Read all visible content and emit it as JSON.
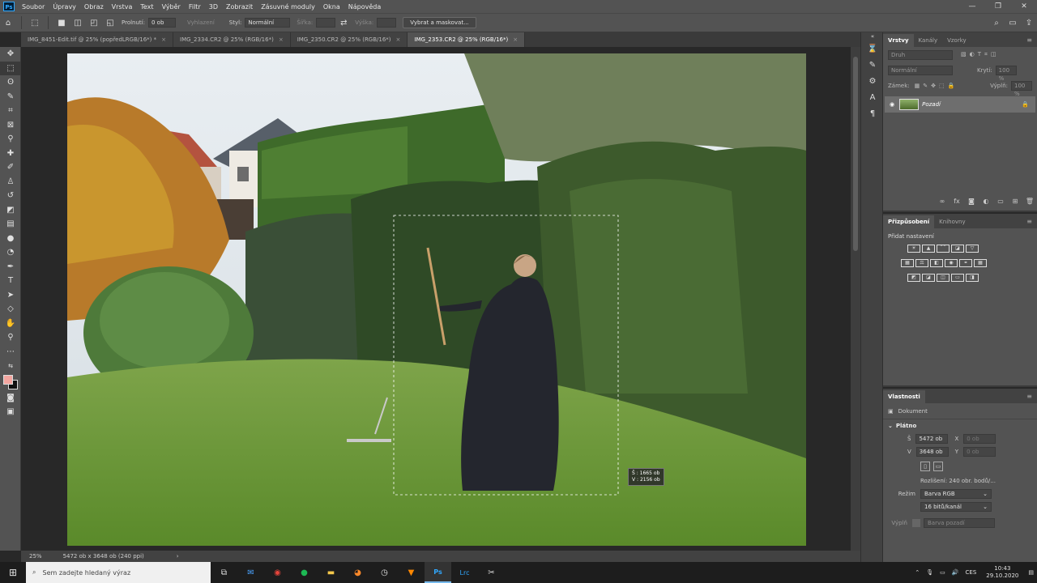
{
  "menubar": {
    "logo": "Ps",
    "items": [
      "Soubor",
      "Úpravy",
      "Obraz",
      "Vrstva",
      "Text",
      "Výběr",
      "Filtr",
      "3D",
      "Zobrazit",
      "Zásuvné moduly",
      "Okna",
      "Nápověda"
    ],
    "window_controls": [
      "—",
      "❐",
      "✕"
    ]
  },
  "options": {
    "feather_label": "Prolnutí:",
    "feather_value": "0 ob",
    "antialias_label": "Vyhlazení",
    "style_label": "Styl:",
    "style_value": "Normální",
    "width_label": "Šířka:",
    "height_label": "Výška:",
    "select_mask_button": "Vybrat a maskovat..."
  },
  "tabs": [
    {
      "label": "IMG_8451-Edit.tif @ 25% (popředLRGB/16*) *",
      "active": false
    },
    {
      "label": "IMG_2334.CR2 @ 25% (RGB/16*)",
      "active": false
    },
    {
      "label": "IMG_2350.CR2 @ 25% (RGB/16*)",
      "active": false
    },
    {
      "label": "IMG_2353.CR2 @ 25% (RGB/16*)",
      "active": true
    }
  ],
  "tab_close": "×",
  "canvas": {
    "selection_readout": {
      "w_label": "Š :",
      "w_value": "1665 ob",
      "h_label": "V :",
      "h_value": "2156 ob"
    }
  },
  "status": {
    "zoom": "25%",
    "doc_size": "5472 ob x 3648 ob (240 ppi)",
    "arrow": "›"
  },
  "layers_panel": {
    "tabs": [
      "Vrstvy",
      "Kanály",
      "Vzorky"
    ],
    "kind_placeholder": "Druh",
    "blend_mode": "Normální",
    "opacity_label": "Krytí:",
    "opacity_value": "100 %",
    "lock_label": "Zámek:",
    "fill_label": "Výplň:",
    "fill_value": "100 %",
    "layer_name": "Pozadí"
  },
  "adjust_panel": {
    "tabs": [
      "Přizpůsobení",
      "Knihovny"
    ],
    "add_label": "Přidat nastavení"
  },
  "props_panel": {
    "title": "Vlastnosti",
    "doc_label": "Dokument",
    "section": "Plátno",
    "w_label": "Š",
    "w_value": "5472 ob",
    "x_label": "X",
    "x_placeholder": "0 ob",
    "h_label": "V",
    "h_value": "3648 ob",
    "y_label": "Y",
    "y_placeholder": "0 ob",
    "resolution": "Rozlišení: 240 obr. bodů/...",
    "mode_label": "Režim",
    "mode_value": "Barva RGB",
    "depth_value": "16 bitů/kanál",
    "fill_label": "Výplň",
    "fill_value": "Barva pozadí"
  },
  "taskbar": {
    "search_placeholder": "Sem zadejte hledaný výraz",
    "lang": "CES",
    "time": "10:43",
    "date": "29.10.2020"
  },
  "colors": {
    "foreground": "#f4a6a0",
    "background": "#111111",
    "accent": "#31a8ff"
  }
}
